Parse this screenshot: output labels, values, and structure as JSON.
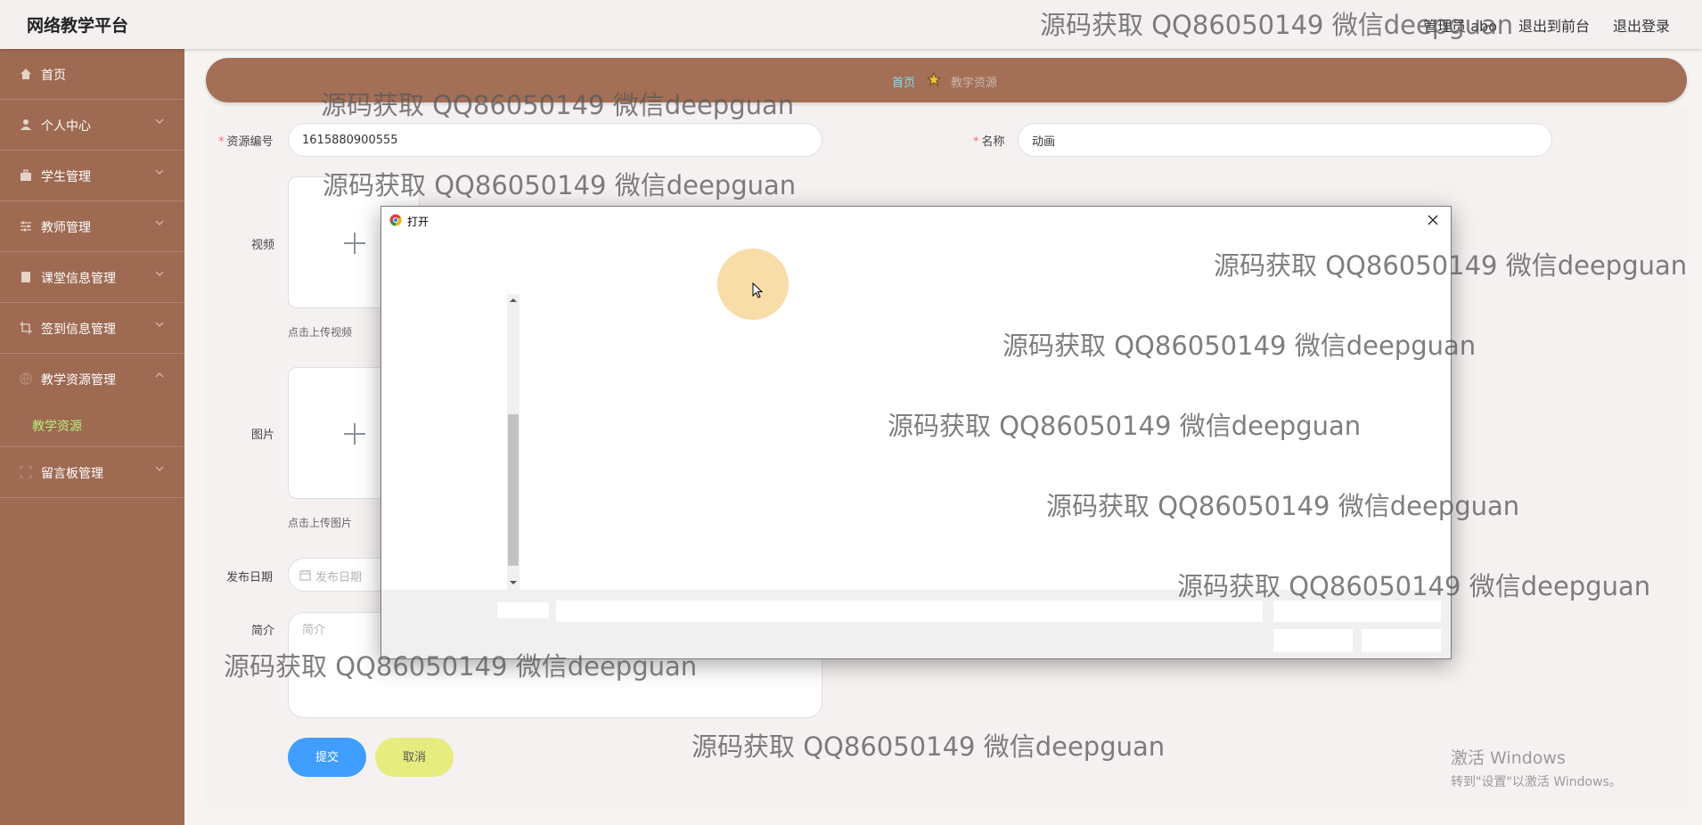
{
  "app": {
    "title": "网络教学平台"
  },
  "header": {
    "user_label": "管理员 abo",
    "front_link": "退出到前台",
    "logout_link": "退出登录"
  },
  "sidebar": {
    "items": [
      {
        "label": "首页",
        "icon": "home-icon"
      },
      {
        "label": "个人中心",
        "icon": "user-icon"
      },
      {
        "label": "学生管理",
        "icon": "briefcase-icon"
      },
      {
        "label": "教师管理",
        "icon": "sliders-icon"
      },
      {
        "label": "课堂信息管理",
        "icon": "book-icon"
      },
      {
        "label": "签到信息管理",
        "icon": "crop-icon"
      },
      {
        "label": "教学资源管理",
        "icon": "globe-icon"
      },
      {
        "label": "留言板管理",
        "icon": "frame-icon"
      }
    ],
    "active_sub": "教学资源",
    "accent_color": "#b8ee7a",
    "background_color": "#9e6a52"
  },
  "breadcrumb": {
    "home": "首页",
    "current": "教学资源"
  },
  "form": {
    "resource_no_label": "资源编号",
    "resource_no_value": "1615880900555",
    "name_label": "名称",
    "name_value": "动画",
    "video_label": "视频",
    "video_hint": "点击上传视频",
    "image_label": "图片",
    "image_hint": "点击上传图片",
    "date_label": "发布日期",
    "date_placeholder": "发布日期",
    "intro_label": "简介",
    "intro_placeholder": "简介",
    "submit_label": "提交",
    "cancel_label": "取消"
  },
  "dialog": {
    "title": "打开"
  },
  "watermark": "源码获取 QQ86050149 微信deepguan",
  "activation": {
    "line1": "激活 Windows",
    "line2": "转到\"设置\"以激活 Windows。"
  }
}
